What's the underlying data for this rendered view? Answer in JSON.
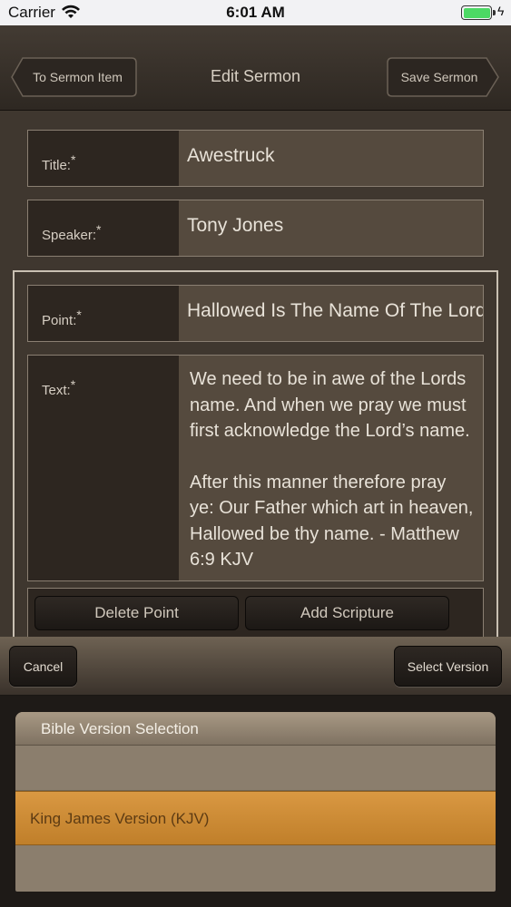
{
  "status_bar": {
    "carrier": "Carrier",
    "time": "6:01 AM",
    "wifi_icon": "wifi-icon",
    "battery_color": "#4cd964"
  },
  "nav": {
    "back_label": "To Sermon Item",
    "title": "Edit Sermon",
    "save_label": "Save Sermon"
  },
  "form": {
    "title_label": "Title:",
    "title_value": "Awestruck",
    "speaker_label": "Speaker:",
    "speaker_value": "Tony Jones",
    "point_label": "Point:",
    "point_value": "Hallowed Is The Name Of The Lord",
    "text_label": "Text:",
    "text_paragraph_1": "We need to be in awe of the Lords name. And when we pray we must first acknowledge the Lord’s name.",
    "text_paragraph_2": "After this manner therefore pray ye: Our Father which art in heaven, Hallowed be thy name. - Matthew 6:9 KJV",
    "required_marker": "*",
    "delete_point_label": "Delete Point",
    "add_scripture_label": "Add Scripture"
  },
  "picker": {
    "cancel_label": "Cancel",
    "select_label": "Select Version",
    "header": "Bible Version Selection",
    "options": [
      "King James Version (KJV)"
    ],
    "selected_index": 0,
    "selected_color": "#d08c36"
  }
}
